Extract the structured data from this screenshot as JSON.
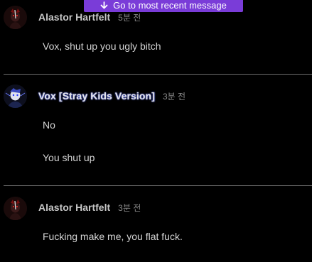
{
  "banner": {
    "label": "Go to most recent message",
    "icon": "arrow-down-icon",
    "color": "#7a3cd8"
  },
  "messages": [
    {
      "author": "Alastor Hartfelt",
      "timestamp": "5분 전",
      "lines": [
        "Vox, shut up you ugly bitch"
      ]
    },
    {
      "author": "Vox [Stray Kids Version]",
      "timestamp": "3분 전",
      "lines": [
        "No",
        "You shut up"
      ]
    },
    {
      "author": "Alastor Hartfelt",
      "timestamp": "3분 전",
      "lines": [
        "Fucking make me, you flat fuck."
      ]
    }
  ]
}
